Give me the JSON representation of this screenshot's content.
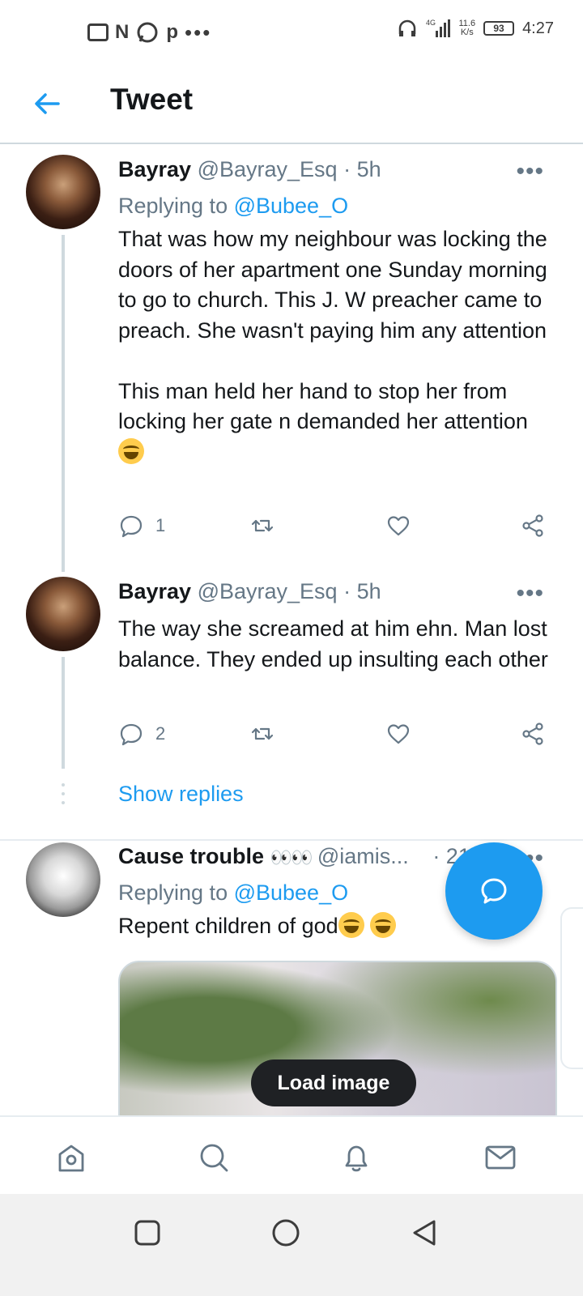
{
  "status_bar": {
    "speed_value": "11.6",
    "speed_unit": "K/s",
    "network": "4G",
    "battery": "93",
    "time": "4:27"
  },
  "header": {
    "title": "Tweet",
    "back_icon": "arrow-left-icon"
  },
  "tweets": [
    {
      "name": "Bayray",
      "handle": "@Bayray_Esq",
      "time": "· 5h",
      "replying_prefix": "Replying to ",
      "replying_to": "@Bubee_O",
      "text": "That was how my neighbour was locking the doors of her apartment one Sunday morning to go to church. This J. W preacher came to preach. She wasn't paying him any attention\n\nThis man held her hand to stop her from locking her gate n demanded her attention",
      "reply_count": "1"
    },
    {
      "name": "Bayray",
      "handle": "@Bayray_Esq",
      "time": "· 5h",
      "text": "The way she screamed at him ehn. Man lost balance. They ended up insulting each other",
      "reply_count": "2"
    },
    {
      "name": "Cause trouble",
      "handle": "@iamis...",
      "time": "· 21h",
      "replying_prefix": "Replying to ",
      "replying_to": "@Bubee_O",
      "text": "Repent children of god"
    }
  ],
  "show_replies": "Show replies",
  "load_image": "Load image",
  "more_glyph": "•••",
  "colors": {
    "accent": "#1d9bf0",
    "secondary_text": "#657786",
    "divider": "#cfd9de"
  },
  "bottom_nav": [
    "home-icon",
    "search-icon",
    "bell-icon",
    "mail-icon"
  ],
  "system_nav": [
    "recents-square-icon",
    "home-circle-icon",
    "back-triangle-icon"
  ]
}
